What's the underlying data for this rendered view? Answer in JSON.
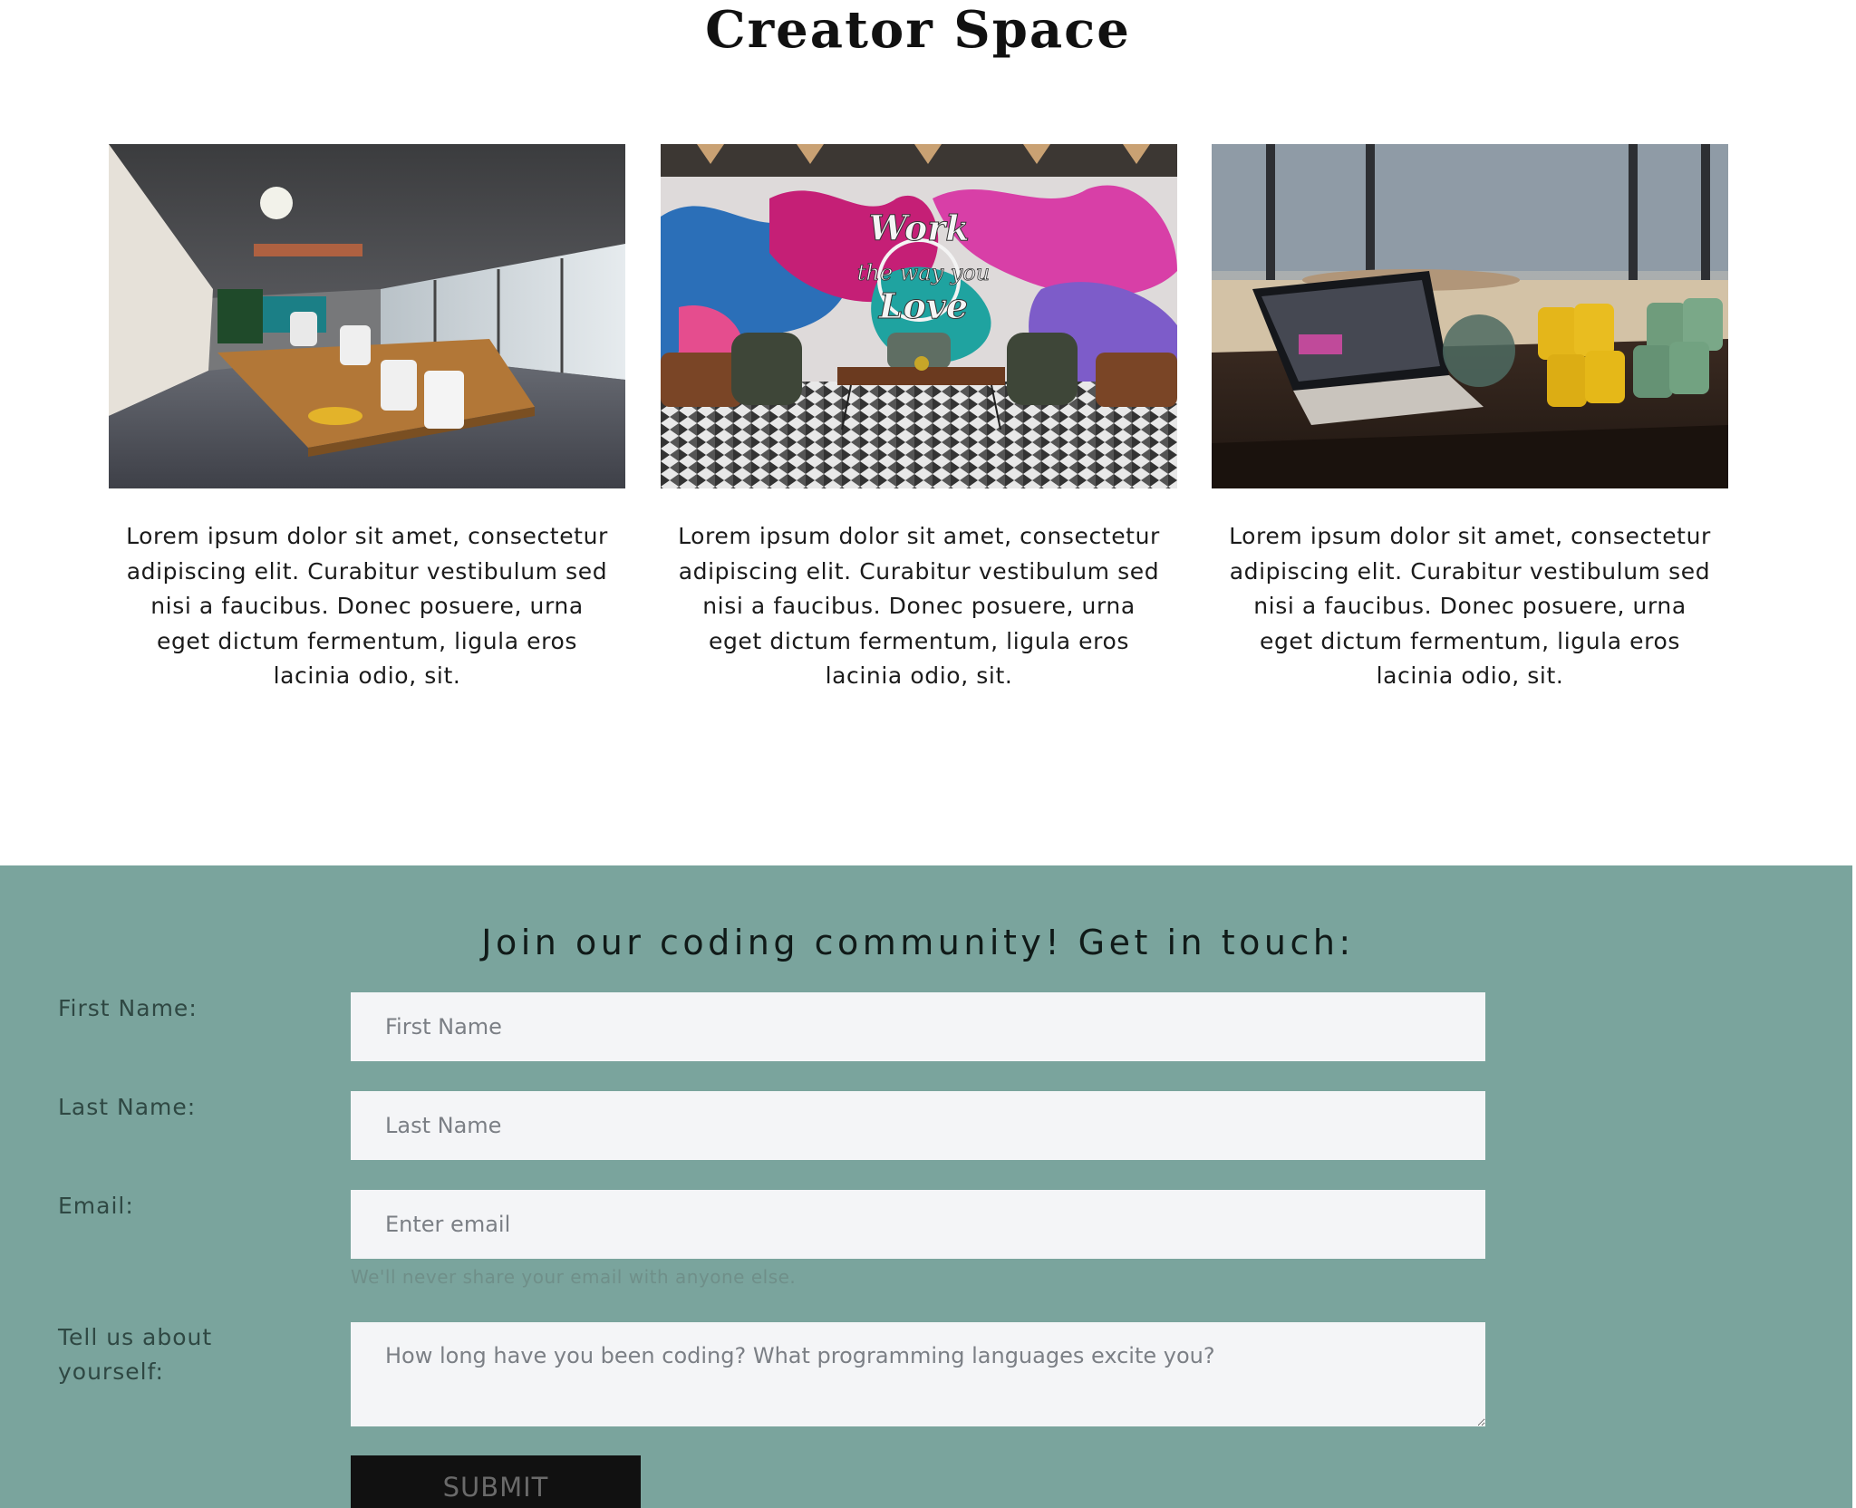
{
  "hero": {
    "title": "Creator Space",
    "cards": [
      {
        "image_alt": "Open-plan coworking office with long wooden desks and grey chairs",
        "text": "Lorem ipsum dolor sit amet, consectetur adipiscing elit. Curabitur vestibulum sed nisi a faucibus. Donec posuere, urna eget dictum fermentum, ligula eros lacinia odio, sit."
      },
      {
        "image_alt": "Lounge with colourful graffiti mural and armchairs",
        "mural_text": "Work the way you Love",
        "text": "Lorem ipsum dolor sit amet, consectetur adipiscing elit. Curabitur vestibulum sed nisi a faucibus. Donec posuere, urna eget dictum fermentum, ligula eros lacinia odio, sit."
      },
      {
        "image_alt": "Laptop on a desk beside yellow and green mugs",
        "text": "Lorem ipsum dolor sit amet, consectetur adipiscing elit. Curabitur vestibulum sed nisi a faucibus. Donec posuere, urna eget dictum fermentum, ligula eros lacinia odio, sit."
      }
    ]
  },
  "contact": {
    "heading": "Join our coding community! Get in touch:",
    "first_name": {
      "label": "First Name:",
      "placeholder": "First Name"
    },
    "last_name": {
      "label": "Last Name:",
      "placeholder": "Last Name"
    },
    "email": {
      "label": "Email:",
      "placeholder": "Enter email",
      "help": "We'll never share your email with anyone else."
    },
    "about": {
      "label": "Tell us about yourself:",
      "placeholder": "How long have you been coding? What programming languages excite you?"
    },
    "submit_label": "SUBMIT"
  },
  "colors": {
    "section_background": "#7aa49d",
    "field_background": "#f4f5f7",
    "button_background": "#111111"
  }
}
